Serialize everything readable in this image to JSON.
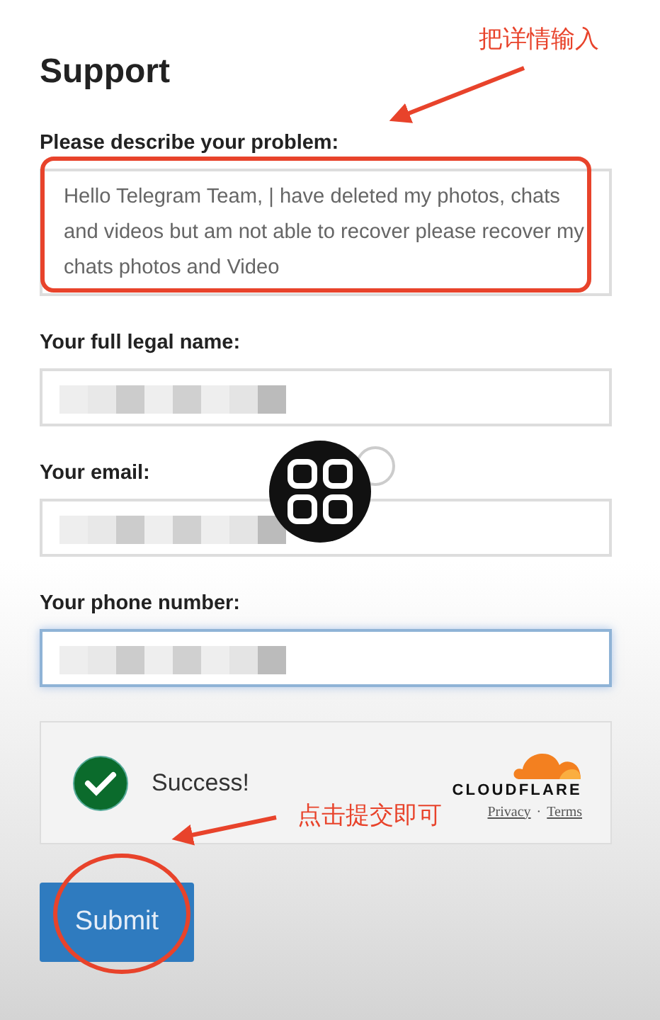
{
  "title": "Support",
  "fields": [
    {
      "kind": "textarea",
      "label": "Please describe your problem:",
      "value": "Hello Telegram Team, | have deleted my photos, chats and videos but am not able to recover please recover my chats photos and Video"
    },
    {
      "kind": "text",
      "label": "Your full legal name:",
      "focused": false,
      "redacted": true
    },
    {
      "kind": "text",
      "label": "Your email:",
      "focused": false,
      "redacted": true
    },
    {
      "kind": "text",
      "label": "Your phone number:",
      "focused": true,
      "redacted": true
    }
  ],
  "captcha": {
    "checked": true,
    "status": "Success!",
    "brand": "CLOUDFLARE",
    "links": [
      "Privacy",
      "Terms"
    ],
    "separator": "·"
  },
  "submit": {
    "label": "Submit"
  },
  "annotations": [
    {
      "kind": "arrow-text",
      "text": "把详情输入"
    },
    {
      "kind": "arrow-text",
      "text": "点击提交即可"
    }
  ]
}
